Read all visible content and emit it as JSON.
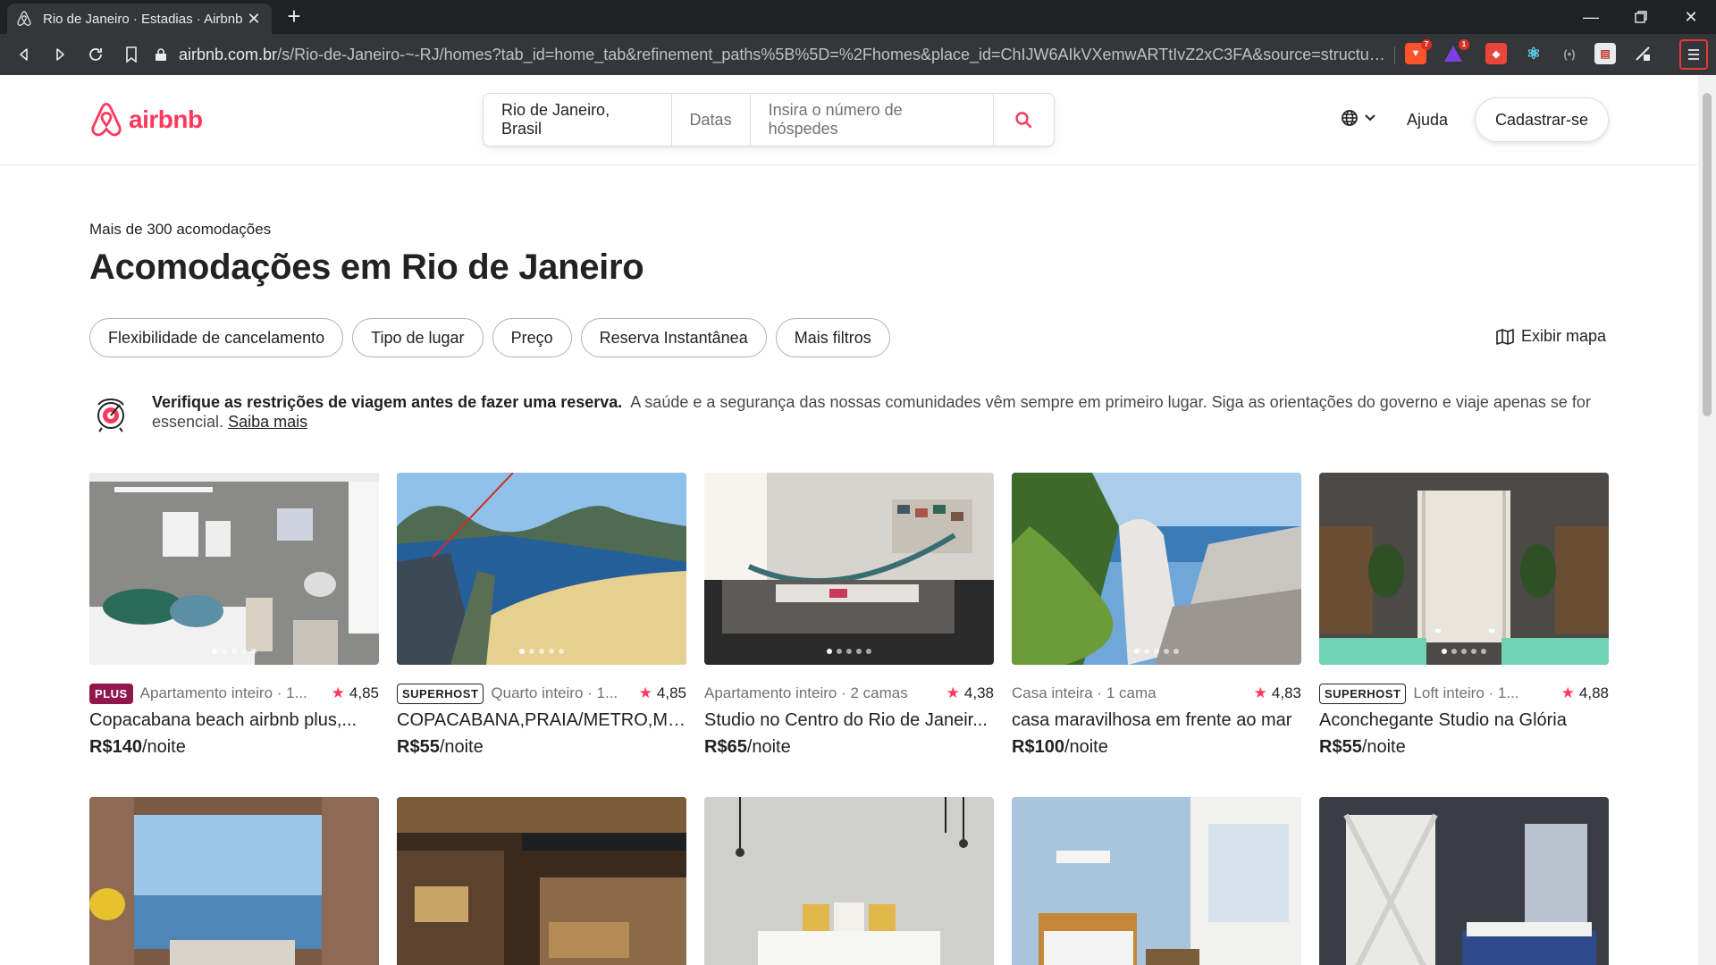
{
  "browser": {
    "tab_title": "Rio de Janeiro · Estadias · Airbnb",
    "url_host": "airbnb.com.br",
    "url_path": "/s/Rio-de-Janeiro-~-RJ/homes?tab_id=home_tab&refinement_paths%5B%5D=%2Fhomes&place_id=ChIJW6AIkVXemwARTtIvZ2xC3FA&source=structured_s...",
    "brave_badge": "7",
    "alert_badge": "1"
  },
  "header": {
    "logo_text": "airbnb",
    "search": {
      "location": "Rio de Janeiro, Brasil",
      "dates": "Datas",
      "guests_placeholder": "Insira o número de hóspedes"
    },
    "help": "Ajuda",
    "signup": "Cadastrar-se"
  },
  "results": {
    "count_text": "Mais de 300 acomodações",
    "title": "Acomodações em Rio de Janeiro",
    "filters": [
      "Flexibilidade de cancelamento",
      "Tipo de lugar",
      "Preço",
      "Reserva Instantânea",
      "Mais filtros"
    ],
    "show_map": "Exibir mapa"
  },
  "notice": {
    "bold": "Verifique as restrições de viagem antes de fazer uma reserva.",
    "body": "A saúde e a segurança das nossas comunidades vêm sempre em primeiro lugar. Siga as orientações do governo e viaje apenas se for essencial.",
    "link": "Saiba mais"
  },
  "listings": [
    {
      "tag": "PLUS",
      "type": "Apartamento inteiro · 1...",
      "rating": "4,85",
      "name": "Copacabana beach airbnb plus,...",
      "price": "R$140",
      "price_unit": "/noite"
    },
    {
      "tag": "SUPERHOST",
      "type": "Quarto inteiro · 1...",
      "rating": "4,85",
      "name": "COPACABANA,PRAIA/METRO,ME...",
      "price": "R$55",
      "price_unit": "/noite"
    },
    {
      "tag": "",
      "type": "Apartamento inteiro · 2 camas",
      "rating": "4,38",
      "name": "Studio no Centro do Rio de Janeir...",
      "price": "R$65",
      "price_unit": "/noite"
    },
    {
      "tag": "",
      "type": "Casa inteira · 1 cama",
      "rating": "4,83",
      "name": "casa maravilhosa em frente ao mar",
      "price": "R$100",
      "price_unit": "/noite"
    },
    {
      "tag": "SUPERHOST",
      "type": "Loft inteiro · 1...",
      "rating": "4,88",
      "name": "Aconchegante Studio na Glória",
      "price": "R$55",
      "price_unit": "/noite"
    }
  ],
  "colors": {
    "brand": "#FF385C",
    "plus": "#92174D",
    "text": "#222222",
    "muted": "#717171"
  }
}
